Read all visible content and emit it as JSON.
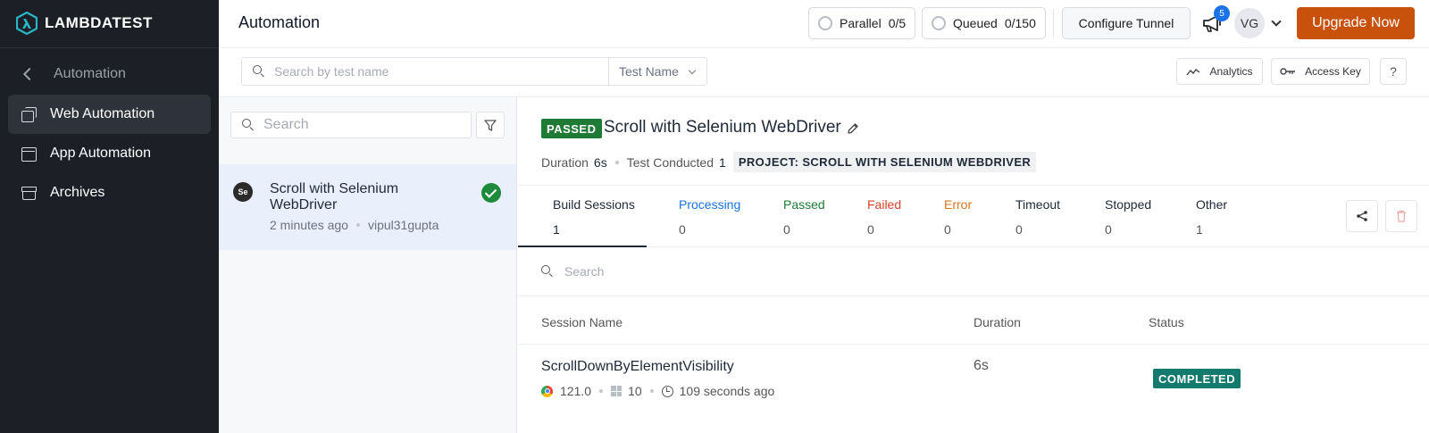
{
  "brand": {
    "name": "LAMBDATEST",
    "accent": "#c8520c"
  },
  "sidebar": {
    "back_label": "Automation",
    "items": [
      {
        "label": "Web Automation",
        "icon": "stack-icon",
        "active": true
      },
      {
        "label": "App Automation",
        "icon": "window-icon",
        "active": false
      },
      {
        "label": "Archives",
        "icon": "archive-icon",
        "active": false
      }
    ]
  },
  "header": {
    "title": "Automation",
    "parallel": {
      "label": "Parallel",
      "count": "0/5"
    },
    "queued": {
      "label": "Queued",
      "count": "0/150"
    },
    "configure_tunnel": "Configure Tunnel",
    "notification_count": "5",
    "avatar_initials": "VG",
    "upgrade": "Upgrade Now"
  },
  "toolbar": {
    "search_placeholder": "Search by test name",
    "search_by": "Test Name",
    "analytics": "Analytics",
    "access_key": "Access Key",
    "help": "?"
  },
  "builds_panel": {
    "search_placeholder": "Search",
    "builds": [
      {
        "name": "Scroll with Selenium WebDriver",
        "time": "2 minutes ago",
        "user": "vipul31gupta",
        "status": "passed"
      }
    ]
  },
  "build_detail": {
    "status": "PASSED",
    "title": "Scroll with Selenium WebDriver",
    "duration_label": "Duration",
    "duration": "6s",
    "conducted_label": "Test Conducted",
    "conducted": "1",
    "project": "PROJECT: SCROLL WITH SELENIUM WEBDRIVER",
    "tabs": [
      {
        "label": "Build Sessions",
        "count": "1",
        "color": "#1f2937"
      },
      {
        "label": "Processing",
        "count": "0",
        "color": "#1a73e8"
      },
      {
        "label": "Passed",
        "count": "0",
        "color": "#1f7a36"
      },
      {
        "label": "Failed",
        "count": "0",
        "color": "#d9432f"
      },
      {
        "label": "Error",
        "count": "0",
        "color": "#d9741f"
      },
      {
        "label": "Timeout",
        "count": "0",
        "color": "#1f2937"
      },
      {
        "label": "Stopped",
        "count": "0",
        "color": "#1f2937"
      },
      {
        "label": "Other",
        "count": "1",
        "color": "#1f2937"
      }
    ],
    "session_search_placeholder": "Search",
    "columns": [
      "Session Name",
      "Duration",
      "Status"
    ],
    "sessions": [
      {
        "name": "ScrollDownByElementVisibility",
        "browser_version": "121.0",
        "os_version": "10",
        "elapsed": "109 seconds ago",
        "duration": "6s",
        "status": "COMPLETED"
      }
    ]
  }
}
